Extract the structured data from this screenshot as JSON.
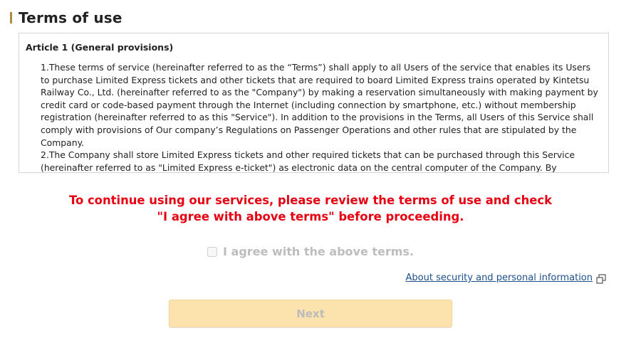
{
  "page": {
    "title": "Terms of use"
  },
  "terms": {
    "article_title": "Article 1 (General provisions)",
    "paragraphs": [
      "1.These terms of service (hereinafter referred to as the “Terms”) shall apply to all Users of the service that enables its Users to purchase Limited Express tickets and other tickets that are required to board Limited Express trains operated by Kintetsu Railway Co., Ltd. (hereinafter referred to as the \"Company\") by making a reservation simultaneously with making payment by credit card or code-based payment through the Internet (including connection by smartphone, etc.) without membership registration (hereinafter referred to as this \"Service\"). In addition to the provisions in the Terms, all Users of this Service shall comply with provisions of Our company’s Regulations on Passenger Operations and other rules that are stipulated by the Company.",
      "2.The Company shall store Limited Express tickets and other required tickets that can be purchased through this Service (hereinafter referred to as \"Limited Express e-ticket\") as electronic data on the central computer of the Company. By"
    ]
  },
  "notice": {
    "line1": "To continue using our services, please review the terms of use and check",
    "line2": "\"I agree with above terms\" before proceeding."
  },
  "agree": {
    "label": "I agree with the above terms.",
    "checked": false
  },
  "links": {
    "security": "About security and personal information",
    "security_icon": "external-window-icon"
  },
  "actions": {
    "next_label": "Next",
    "next_enabled": false
  },
  "colors": {
    "accent_bar": "#b08a3e",
    "notice": "#e60012",
    "link": "#1d4f8a",
    "button_disabled_bg": "#fce2ad"
  }
}
